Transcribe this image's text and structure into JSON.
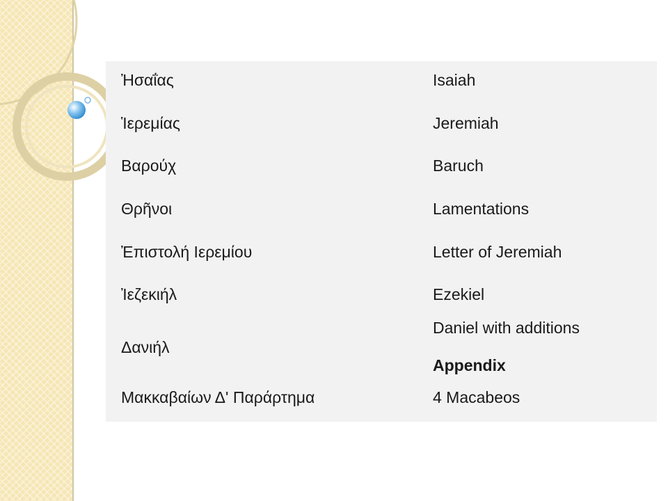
{
  "rows": [
    {
      "greek": "Ἠσαΐας",
      "english": "Isaiah"
    },
    {
      "greek": "Ἱερεμίας",
      "english": "Jeremiah"
    },
    {
      "greek": "Βαρούχ",
      "english": "Baruch"
    },
    {
      "greek": "Θρῆνοι",
      "english": "Lamentations"
    },
    {
      "greek": "Ἐπιστολή Ιερεμίου",
      "english": "Letter of Jeremiah"
    },
    {
      "greek": "Ἰεζεκιήλ",
      "english": "Ezekiel"
    },
    {
      "greek": "Δανιήλ",
      "english": "Daniel with additions"
    },
    {
      "greek": "Μακκαβαίων Δ' Παράρτημα",
      "english": "4 Macabeos"
    }
  ],
  "appendix_label": "Appendix",
  "colors": {
    "sidebar": "#f6e6b4",
    "panel": "#f2f2f2",
    "text": "#1a1a1a",
    "ring": "#e2d3a4",
    "bubble": "#4aa3df"
  }
}
